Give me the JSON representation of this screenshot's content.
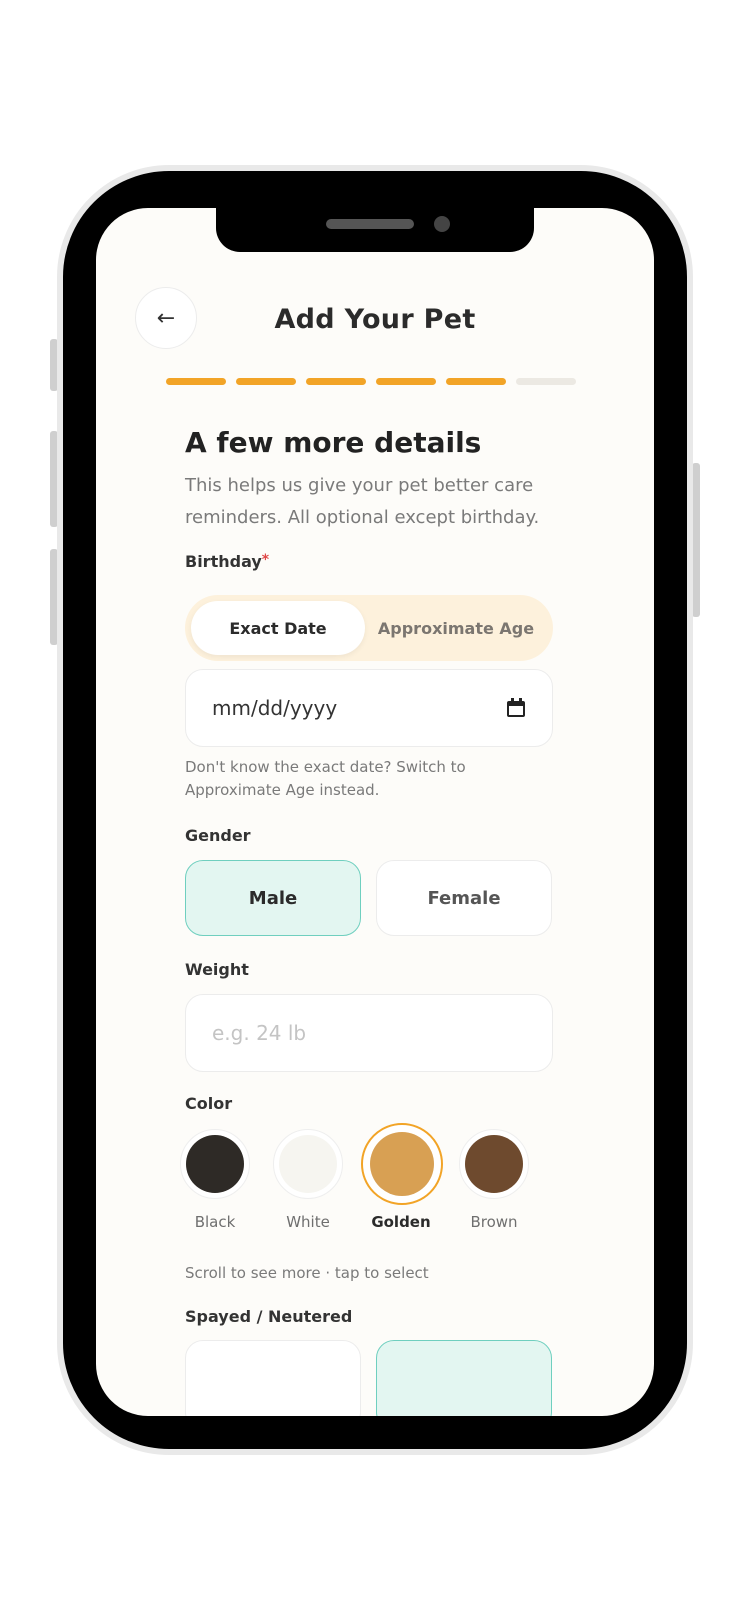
{
  "header": {
    "title": "Add Your Pet",
    "back_label": "←"
  },
  "progress": {
    "current_step": 5,
    "total_steps": 6
  },
  "section": {
    "heading": "A few more details",
    "subtext": "This helps us give your pet better care reminders. All optional except birthday."
  },
  "birthday": {
    "label": "Birthday",
    "required_mark": "*",
    "mode_options": [
      "Exact Date",
      "Approximate Age"
    ],
    "selected_mode": "Exact Date",
    "date_placeholder": "mm/dd/yyyy",
    "helper": "Don't know the exact date? Switch to Approximate Age instead."
  },
  "gender": {
    "label": "Gender",
    "options": [
      "Male",
      "Female"
    ],
    "selected": "Male"
  },
  "weight": {
    "label": "Weight",
    "placeholder": "e.g. 24 lb"
  },
  "color": {
    "label": "Color",
    "swatches": [
      {
        "name": "Black",
        "hex": "#2e2a26"
      },
      {
        "name": "White",
        "hex": "#f6f5f0"
      },
      {
        "name": "Golden",
        "hex": "#d8a053"
      },
      {
        "name": "Brown",
        "hex": "#6e4a2e"
      }
    ],
    "selected": "Golden",
    "helper": "Scroll to see more · tap to select"
  },
  "spayed": {
    "label": "Spayed / Neutered"
  },
  "theme": {
    "accent": "#f2a427",
    "selected_bg": "#e3f6f1",
    "selected_border": "#6fcfbf"
  }
}
